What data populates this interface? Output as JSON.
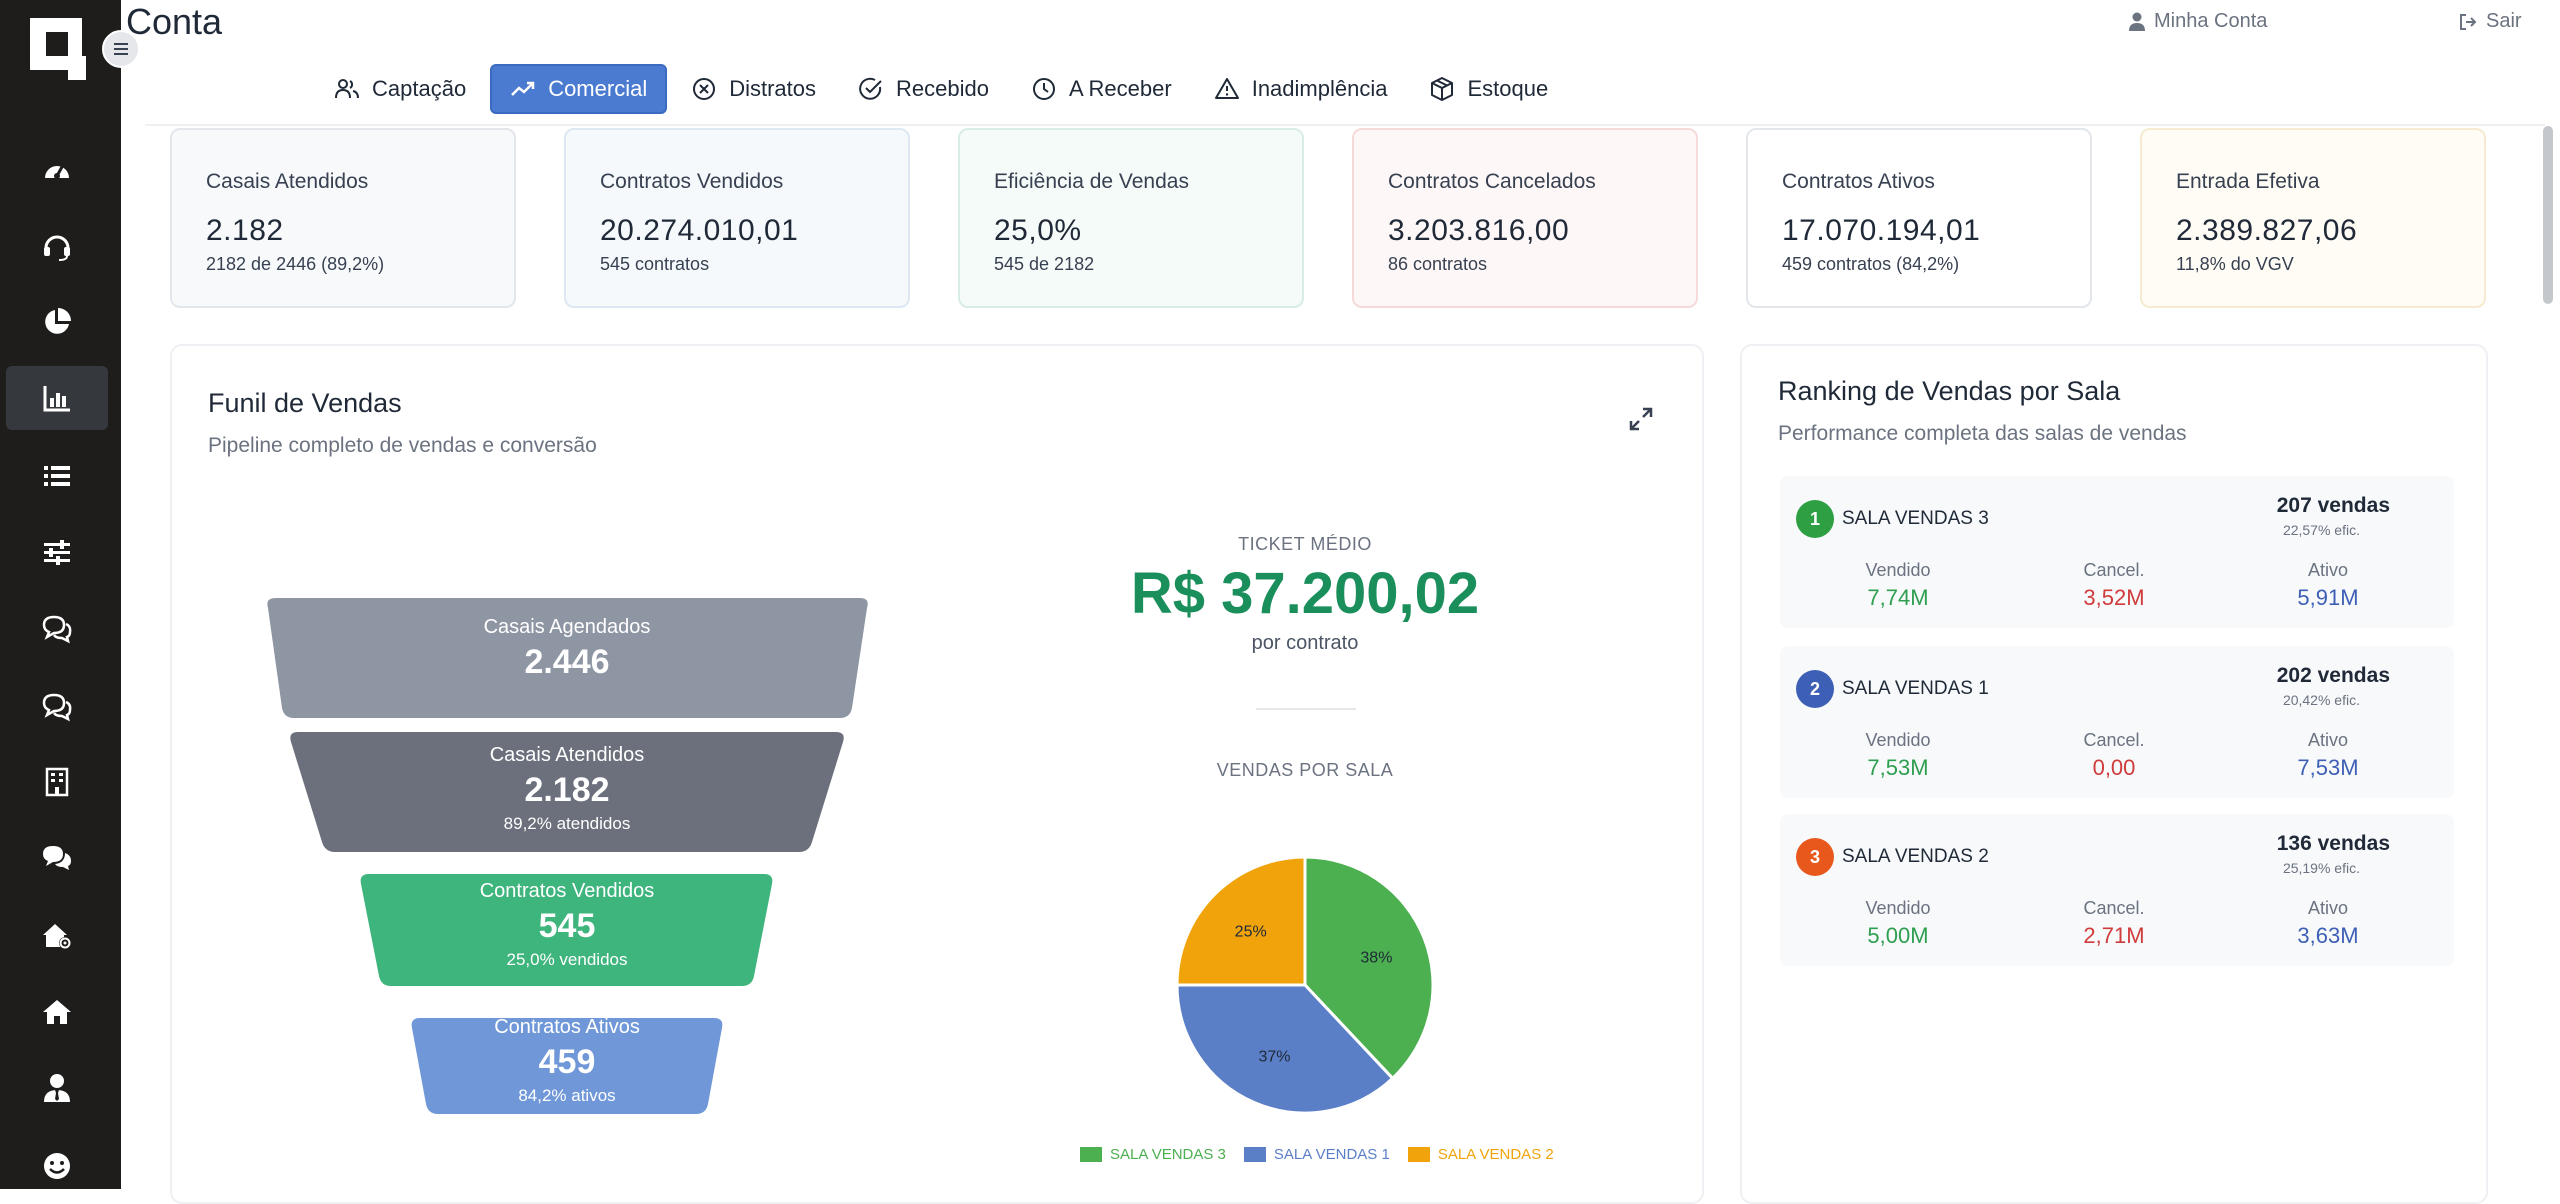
{
  "app": {
    "title": "Conta"
  },
  "header": {
    "account_label": "Minha Conta",
    "logout_label": "Sair"
  },
  "tabs": [
    {
      "label": "Captação",
      "icon": "users-icon"
    },
    {
      "label": "Comercial",
      "icon": "trend-up-icon",
      "active": true
    },
    {
      "label": "Distratos",
      "icon": "x-circle-icon"
    },
    {
      "label": "Recebido",
      "icon": "check-circle-icon"
    },
    {
      "label": "A Receber",
      "icon": "clock-icon"
    },
    {
      "label": "Inadimplência",
      "icon": "alert-triangle-icon"
    },
    {
      "label": "Estoque",
      "icon": "box-icon"
    }
  ],
  "sidebar": {
    "items": [
      {
        "icon": "dashboard-gauge-icon"
      },
      {
        "icon": "headset-icon"
      },
      {
        "icon": "pie-chart-icon"
      },
      {
        "icon": "bar-chart-icon",
        "active": true
      },
      {
        "icon": "list-icon"
      },
      {
        "icon": "sliders-icon"
      },
      {
        "icon": "chat-bubbles-icon"
      },
      {
        "icon": "chat-bubbles-outline-icon"
      },
      {
        "icon": "building-icon"
      },
      {
        "icon": "comments-icon"
      },
      {
        "icon": "house-settings-icon"
      },
      {
        "icon": "home-icon"
      },
      {
        "icon": "user-tie-icon"
      },
      {
        "icon": "smile-icon"
      }
    ]
  },
  "kpis": [
    {
      "label": "Casais Atendidos",
      "value": "2.182",
      "sub": "2182 de 2446 (89,2%)",
      "accent": "#e3e7ec",
      "bg": "#f7f9fb"
    },
    {
      "label": "Contratos Vendidos",
      "value": "20.274.010,01",
      "sub": "545 contratos",
      "accent": "#dde8f3",
      "bg": "#f6f9fc"
    },
    {
      "label": "Eficiência de Vendas",
      "value": "25,0%",
      "sub": "545 de 2182",
      "accent": "#d8ede4",
      "bg": "#f5fbf8"
    },
    {
      "label": "Contratos Cancelados",
      "value": "3.203.816,00",
      "sub": "86 contratos",
      "accent": "#f6dada",
      "bg": "#fef7f7"
    },
    {
      "label": "Contratos Ativos",
      "value": "17.070.194,01",
      "sub": "459 contratos (84,2%)",
      "accent": "#e3e7ec",
      "bg": "#ffffff"
    },
    {
      "label": "Entrada Efetiva",
      "value": "2.389.827,06",
      "sub": "11,8% do VGV",
      "accent": "#f6ead0",
      "bg": "#fffcf5"
    }
  ],
  "funnel": {
    "title": "Funil de Vendas",
    "subtitle": "Pipeline completo de vendas e conversão",
    "stages": [
      {
        "label": "Casais Agendados",
        "value": "2.446",
        "sub": "",
        "color": "#8e95a3"
      },
      {
        "label": "Casais Atendidos",
        "value": "2.182",
        "sub": "89,2% atendidos",
        "color": "#6b707c"
      },
      {
        "label": "Contratos Vendidos",
        "value": "545",
        "sub": "25,0% vendidos",
        "color": "#3fb57e"
      },
      {
        "label": "Contratos Ativos",
        "value": "459",
        "sub": "84,2% ativos",
        "color": "#7098d8"
      }
    ]
  },
  "ticket": {
    "label": "TICKET MÉDIO",
    "value": "R$ 37.200,02",
    "sub": "por contrato"
  },
  "chart_data": {
    "type": "pie",
    "title": "VENDAS POR SALA",
    "series": [
      {
        "name": "SALA VENDAS 3",
        "value": 38,
        "label": "38%",
        "color": "#4caf50"
      },
      {
        "name": "SALA VENDAS 1",
        "value": 37,
        "label": "37%",
        "color": "#5b7fc7"
      },
      {
        "name": "SALA VENDAS 2",
        "value": 25,
        "label": "25%",
        "color": "#f0a30a"
      }
    ],
    "legend_position": "bottom"
  },
  "ranking": {
    "title": "Ranking de Vendas por Sala",
    "subtitle": "Performance completa das salas de vendas",
    "stat_labels": {
      "sold": "Vendido",
      "cancel": "Cancel.",
      "active": "Ativo"
    },
    "rooms": [
      {
        "rank": "1",
        "name": "SALA VENDAS 3",
        "sales": "207 vendas",
        "eff": "22,57% efic.",
        "sold": "7,74M",
        "cancel": "3,52M",
        "active": "5,91M",
        "badge": "#2ea043"
      },
      {
        "rank": "2",
        "name": "SALA VENDAS 1",
        "sales": "202 vendas",
        "eff": "20,42% efic.",
        "sold": "7,53M",
        "cancel": "0,00",
        "active": "7,53M",
        "badge": "#3d5fb5"
      },
      {
        "rank": "3",
        "name": "SALA VENDAS 2",
        "sales": "136 vendas",
        "eff": "25,19% efic.",
        "sold": "5,00M",
        "cancel": "2,71M",
        "active": "3,63M",
        "badge": "#e8581c"
      }
    ]
  },
  "colors": {
    "sold": "#2e9e4f",
    "cancel": "#d03b3b",
    "active": "#3d5fb5",
    "accent": "#4a7bd0"
  }
}
